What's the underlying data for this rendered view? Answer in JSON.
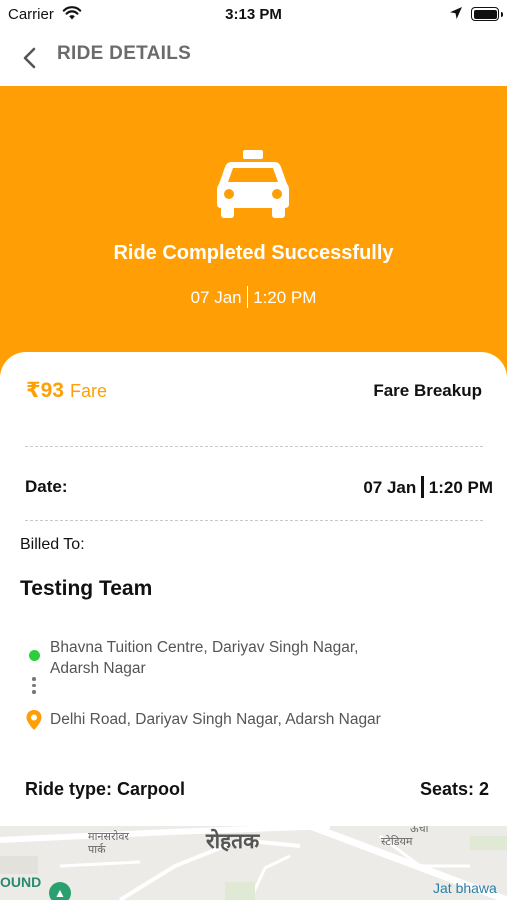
{
  "status_bar": {
    "carrier": "Carrier",
    "time": "3:13 PM"
  },
  "nav": {
    "title": "RIDE DETAILS",
    "back_icon": "chevron-left-icon"
  },
  "hero": {
    "icon": "taxi-icon",
    "title": "Ride Completed Successfully",
    "date": "07 Jan",
    "time": "1:20 PM",
    "background_color": "#FF9F05"
  },
  "fare": {
    "amount": "₹93",
    "label": "Fare",
    "breakup_link": "Fare Breakup",
    "accent_color": "#FF9F05"
  },
  "date_row": {
    "label": "Date:",
    "date": "07 Jan",
    "time": "1:20 PM"
  },
  "billing": {
    "label": "Billed To:",
    "name": "Testing Team"
  },
  "route": {
    "pickup": "Bhavna Tuition Centre, Dariyav Singh Nagar, Adarsh Nagar",
    "drop": "Delhi Road, Dariyav Singh Nagar, Adarsh Nagar",
    "pickup_color": "#2ecc40",
    "drop_color": "#FF9F05"
  },
  "ride": {
    "type_text": "Ride type: Carpool",
    "seats_text": "Seats: 2"
  },
  "map": {
    "city_label": "रोहतक",
    "park_label_line1": "मानसरोवर",
    "park_label_line2": "पार्क",
    "stadium_label_line1": "स्टेडियम",
    "top_right_fragment": "ऊंचा",
    "round_label": "OUND",
    "jat_label": "Jat bhawa"
  }
}
